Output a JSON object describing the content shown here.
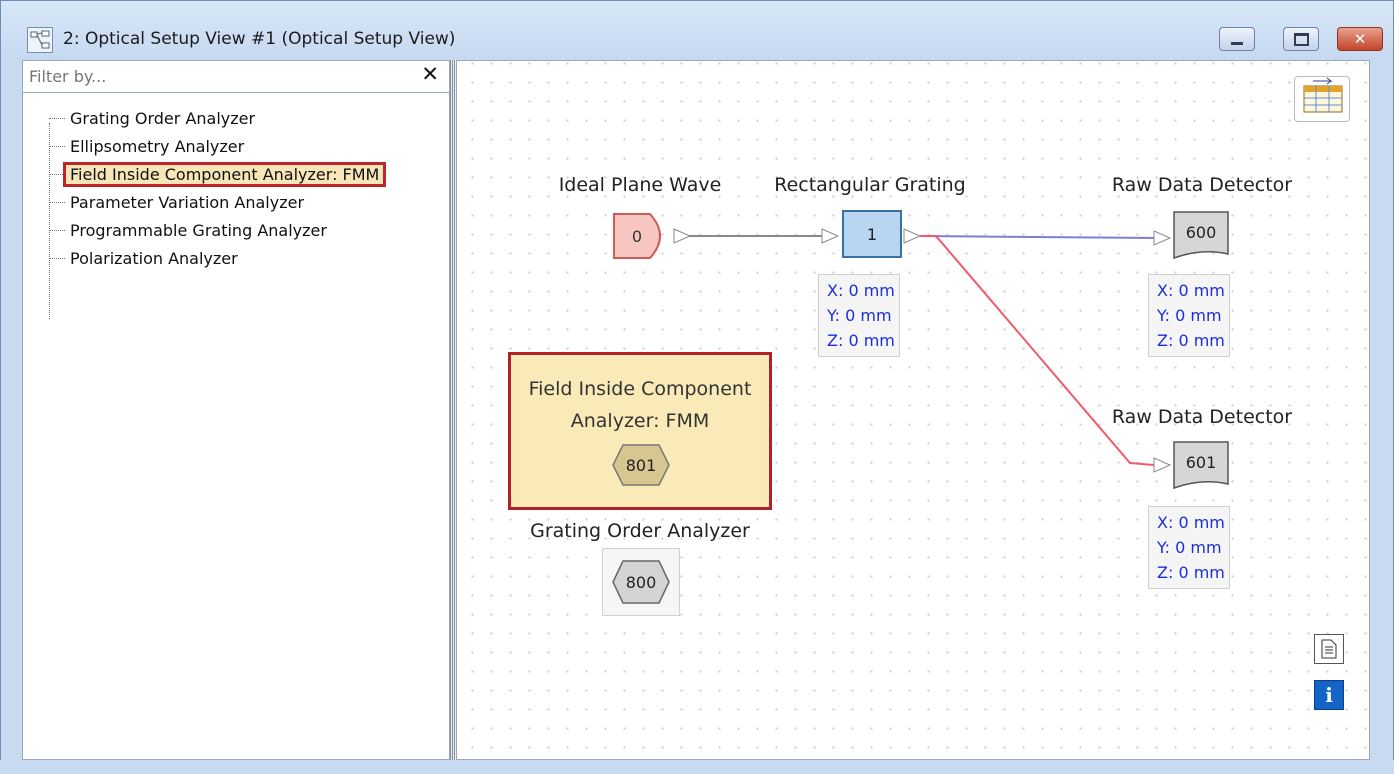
{
  "window": {
    "title": "2: Optical Setup View #1 (Optical Setup View)",
    "icon": "optical-setup-icon"
  },
  "sidebar": {
    "filter_placeholder": "Filter by...",
    "clear_icon": "close-icon",
    "items": [
      {
        "label": "Grating Order Analyzer",
        "selected": false
      },
      {
        "label": "Ellipsometry Analyzer",
        "selected": false
      },
      {
        "label": "Field Inside Component Analyzer: FMM",
        "selected": true
      },
      {
        "label": "Parameter Variation Analyzer",
        "selected": false
      },
      {
        "label": "Programmable Grating Analyzer",
        "selected": false
      },
      {
        "label": "Polarization Analyzer",
        "selected": false
      }
    ]
  },
  "canvas": {
    "nodes": {
      "source": {
        "label": "Ideal Plane Wave",
        "id": "0"
      },
      "grating": {
        "label": "Rectangular Grating",
        "id": "1",
        "coords": [
          "X: 0 mm",
          "Y: 0 mm",
          "Z: 0 mm"
        ]
      },
      "detector_a": {
        "label": "Raw Data Detector",
        "id": "600",
        "coords": [
          "X: 0 mm",
          "Y: 0 mm",
          "Z: 0 mm"
        ]
      },
      "detector_b": {
        "label": "Raw Data Detector",
        "id": "601",
        "coords": [
          "X: 0 mm",
          "Y: 0 mm",
          "Z: 0 mm"
        ]
      },
      "fmm_analyzer": {
        "label_line1": "Field Inside Component",
        "label_line2": "Analyzer: FMM",
        "id": "801"
      },
      "order_analyzer": {
        "label": "Grating Order Analyzer",
        "id": "800"
      }
    },
    "buttons": {
      "table": "table-view-icon",
      "document": "document-icon",
      "info": "info-icon"
    },
    "colors": {
      "source_fill": "#f7c6c2",
      "grating_fill": "#b8d5f2",
      "detector_fill": "#d6d6d6",
      "highlight": "#faeab8",
      "highlight_border": "#b4202a",
      "link_blue": "#7b7fd6",
      "link_red": "#f05a6a",
      "coord_text": "#1d2ddc"
    }
  }
}
